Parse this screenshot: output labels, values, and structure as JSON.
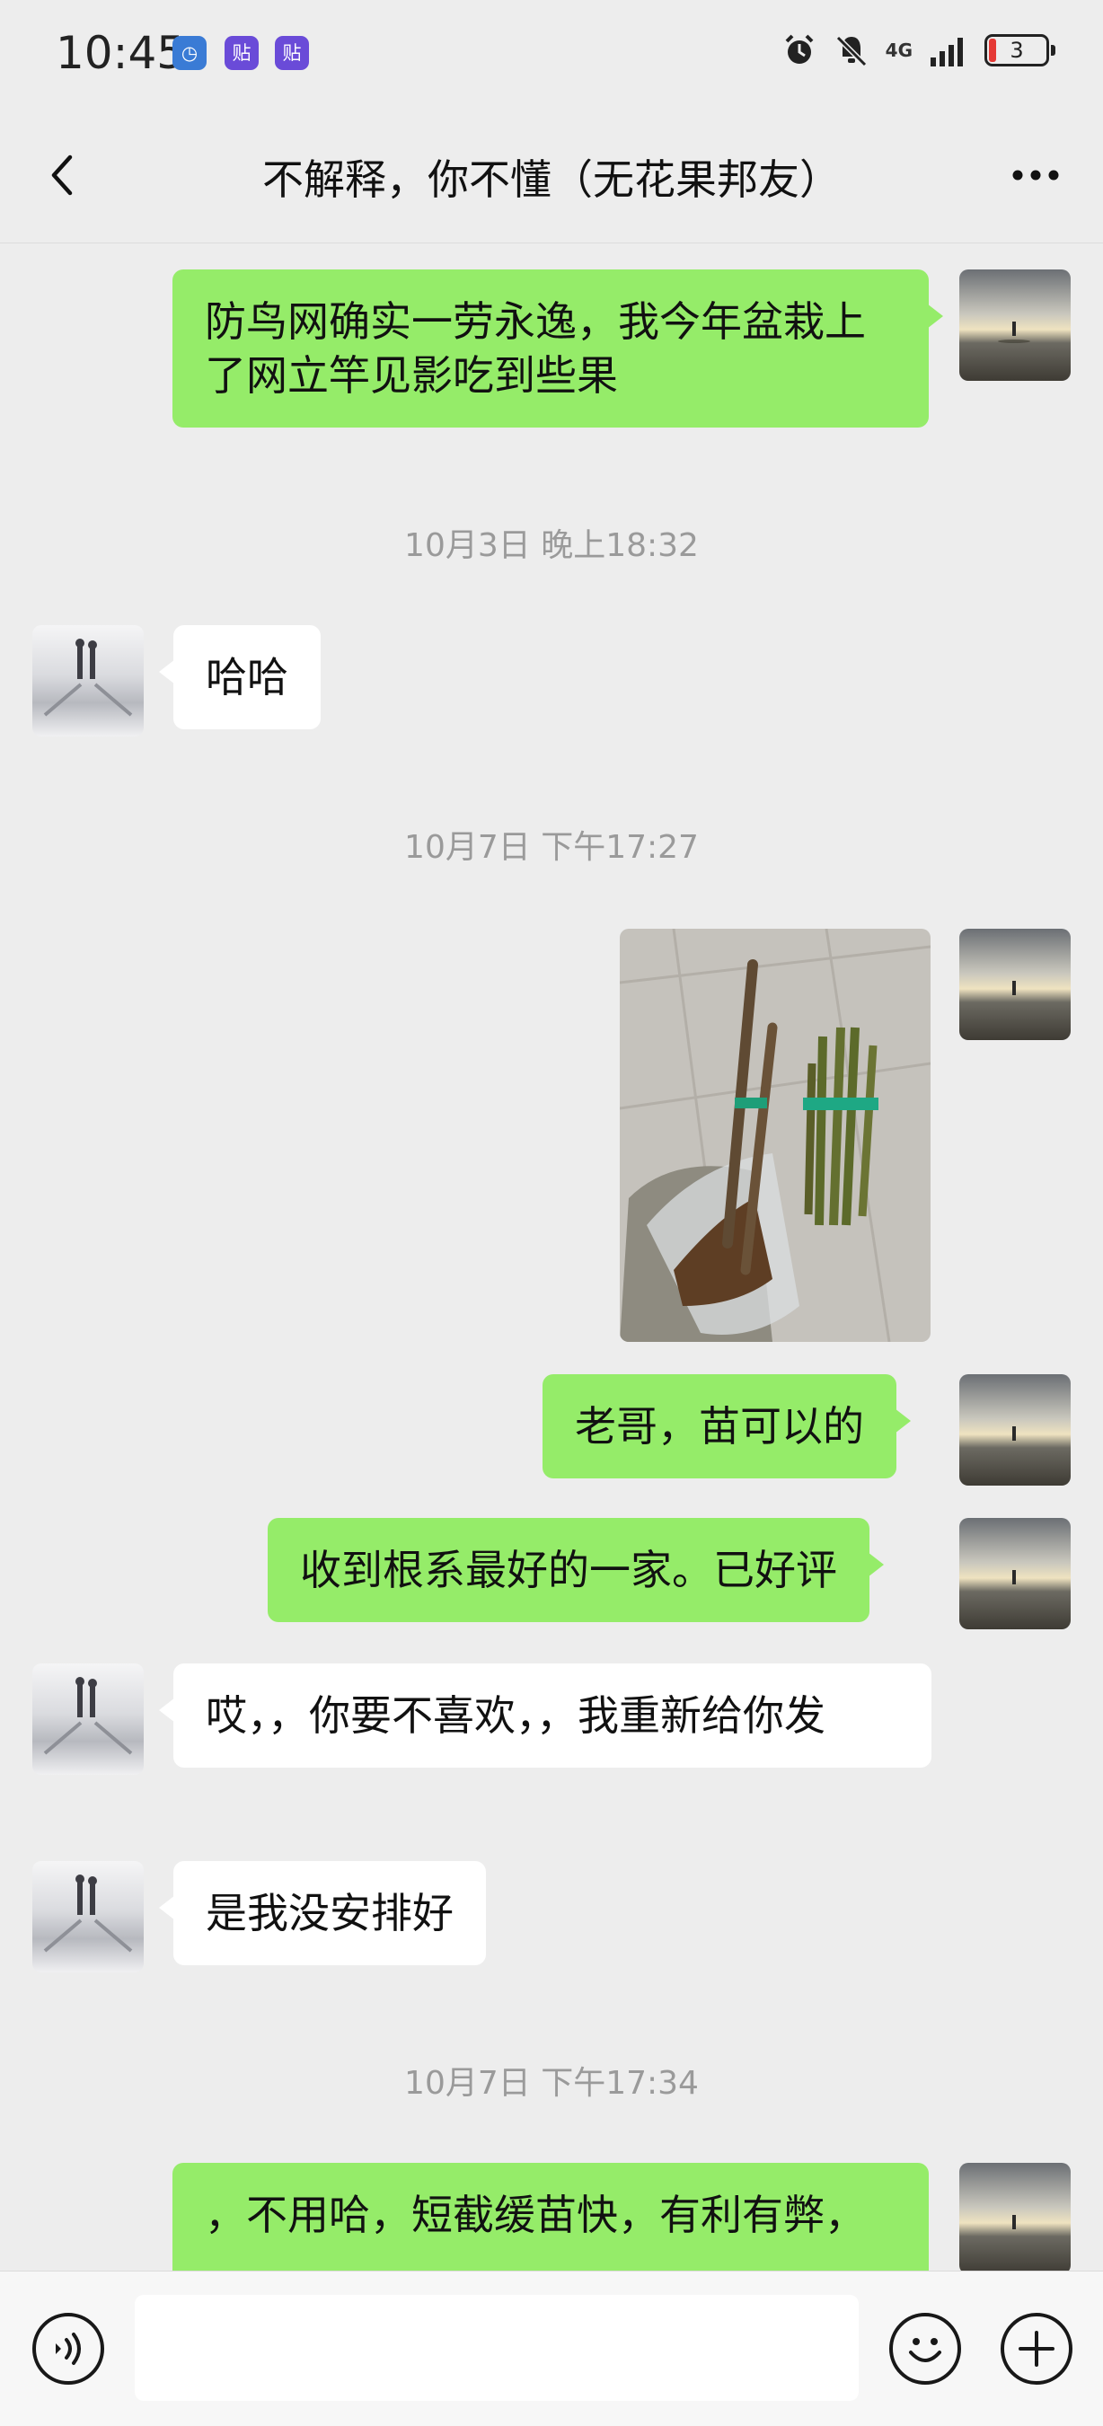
{
  "status_bar": {
    "time": "10:45",
    "app_icons": [
      {
        "icon": "clock-app-icon",
        "glyph": "◷"
      },
      {
        "icon": "tieba-icon",
        "glyph": "贴"
      },
      {
        "icon": "tieba-icon",
        "glyph": "贴"
      }
    ],
    "network": "4G",
    "battery": "3",
    "indicators": [
      "alarm-icon",
      "mute-icon",
      "signal-icon",
      "battery-icon"
    ]
  },
  "header": {
    "title": "不解释，你不懂（无花果邦友）",
    "back_icon": "chevron-left-icon",
    "more_icon": "more-icon"
  },
  "messages": [
    {
      "from": "me",
      "type": "text",
      "text": "防鸟网确实一劳永逸，我今年盆栽上了网立竿见影吃到些果"
    },
    {
      "type": "timestamp",
      "text": "10月3日 晚上18:32"
    },
    {
      "from": "other",
      "type": "text",
      "text": "哈哈"
    },
    {
      "type": "timestamp",
      "text": "10月7日 下午17:27"
    },
    {
      "from": "me",
      "type": "image",
      "description": "photo-fig-cuttings"
    },
    {
      "from": "me",
      "type": "text",
      "text": "老哥，苗可以的"
    },
    {
      "from": "me",
      "type": "text",
      "text": "收到根系最好的一家。已好评"
    },
    {
      "from": "other",
      "type": "text",
      "text": "哎，，你要不喜欢，，我重新给你发"
    },
    {
      "from": "other",
      "type": "text",
      "text": "是我没安排好"
    },
    {
      "type": "timestamp",
      "text": "10月7日 下午17:34"
    },
    {
      "from": "me",
      "type": "text",
      "text": "，不用哈，短截缓苗快，有利有弊，"
    }
  ],
  "input_bar": {
    "voice_icon": "voice-icon",
    "emoji_icon": "emoji-icon",
    "plus_icon": "plus-icon",
    "input_value": ""
  },
  "colors": {
    "background": "#ededed",
    "my_bubble": "#95ec69",
    "other_bubble": "#ffffff",
    "timestamp": "#9a9a9a",
    "input_bar": "#f7f7f7",
    "battery_low": "#e53935"
  }
}
